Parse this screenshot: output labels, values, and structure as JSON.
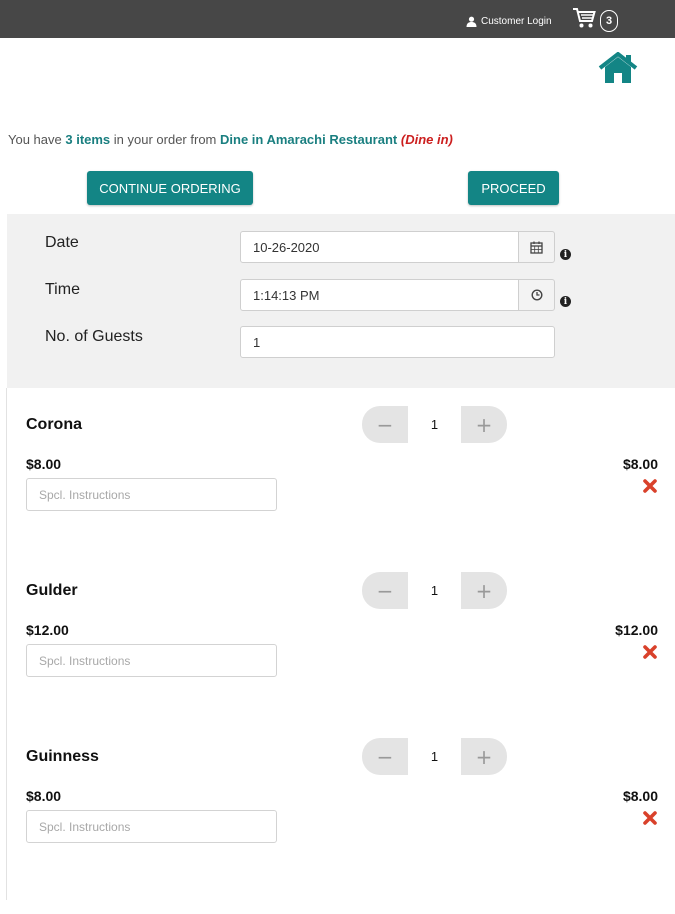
{
  "header": {
    "login_label": "Customer Login",
    "cart_count": "3"
  },
  "summary": {
    "prefix": "You have ",
    "items": "3 items",
    "middle": " in your order from ",
    "restaurant": "Dine in Amarachi Restaurant",
    "mode": "(Dine in)"
  },
  "buttons": {
    "continue": "CONTINUE ORDERING",
    "proceed": "PROCEED"
  },
  "form": {
    "date_label": "Date",
    "date_value": "10-26-2020",
    "time_label": "Time",
    "time_value": "1:14:13 PM",
    "guests_label": "No. of Guests",
    "guests_value": "1"
  },
  "items": [
    {
      "name": "Corona",
      "price": "$8.00",
      "qty": "1",
      "total": "$8.00",
      "placeholder": "Spcl. Instructions"
    },
    {
      "name": "Gulder",
      "price": "$12.00",
      "qty": "1",
      "total": "$12.00",
      "placeholder": "Spcl. Instructions"
    },
    {
      "name": "Guinness",
      "price": "$8.00",
      "qty": "1",
      "total": "$8.00",
      "placeholder": "Spcl. Instructions"
    }
  ],
  "colors": {
    "accent": "#138585",
    "topbar": "#474747",
    "remove": "#d9412b",
    "mode_text": "#cc1f1f"
  },
  "icons": [
    "user-icon",
    "cart-icon",
    "home-icon",
    "calendar-icon",
    "clock-icon",
    "info-icon",
    "minus-icon",
    "plus-icon",
    "remove-icon"
  ]
}
